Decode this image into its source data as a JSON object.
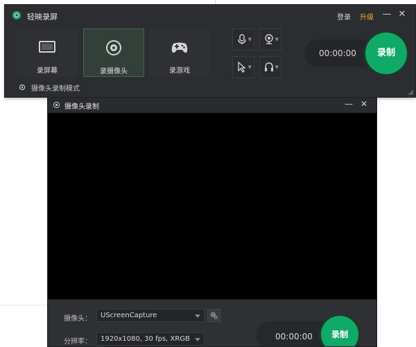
{
  "main_window": {
    "title": "轻映录屏",
    "header": {
      "login": "登录",
      "upgrade": "升级",
      "minimize_glyph": "—",
      "close_glyph": "✕"
    },
    "modes": [
      {
        "label": "录屏幕",
        "icon": "monitor-icon",
        "active": false
      },
      {
        "label": "录摄像头",
        "icon": "webcam-icon",
        "active": true
      },
      {
        "label": "录游戏",
        "icon": "gamepad-icon",
        "active": false
      }
    ],
    "tools": [
      {
        "icon": "microphone-icon"
      },
      {
        "icon": "webcam-overlay-icon"
      },
      {
        "icon": "cursor-icon"
      },
      {
        "icon": "headphones-icon"
      }
    ],
    "timer": "00:00:00",
    "record_label": "录制",
    "camera_mode_label": "摄像头录制模式"
  },
  "camera_window": {
    "title": "摄像头录制",
    "minimize_glyph": "—",
    "close_glyph": "✕",
    "camera_label": "摄像头：",
    "camera_value": "UScreenCapture",
    "resolution_label": "分辨率：",
    "resolution_value": "1920x1080, 30 fps, XRGB",
    "timer": "00:00:00",
    "record_label": "录制"
  },
  "colors": {
    "accent_green": "#11a967",
    "upgrade_orange": "#f0a935",
    "window_bg": "#2c2d31"
  }
}
